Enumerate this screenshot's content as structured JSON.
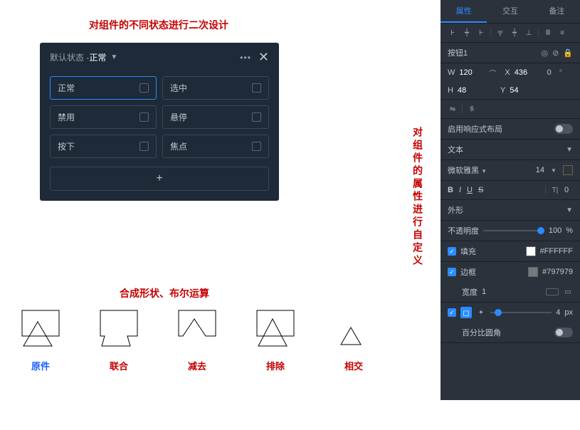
{
  "annotations": {
    "top": "对组件的不同状态进行二次设计",
    "mid": "对组件的属性进行自定义",
    "shape": "合成形状、布尔运算"
  },
  "states_panel": {
    "title_prefix": "默认状态 - ",
    "title_value": "正常",
    "states": {
      "normal": "正常",
      "selected": "选中",
      "disabled": "禁用",
      "hover": "悬停",
      "pressed": "按下",
      "focus": "焦点"
    },
    "add": "+"
  },
  "inspector": {
    "tabs": {
      "attr": "属性",
      "ia": "交互",
      "note": "备注"
    },
    "element_name": "按钮1",
    "geom": {
      "w_label": "W",
      "w": "120",
      "x_label": "X",
      "x": "436",
      "r": "0",
      "h_label": "H",
      "h": "48",
      "y_label": "Y",
      "y": "54"
    },
    "responsive_label": "启用响应式布局",
    "text_section": "文本",
    "font": "微软雅黑",
    "font_size": "14",
    "shape_section": "外形",
    "opacity_label": "不透明度",
    "opacity_value": "100",
    "opacity_unit": "%",
    "fill_label": "填充",
    "fill_value": "#FFFFFF",
    "stroke_label": "边框",
    "stroke_value": "#797979",
    "width_label": "宽度",
    "width_value": "1",
    "radius_value": "4",
    "radius_unit": "px",
    "radius_mode_label": "百分比圆角"
  },
  "shapes": {
    "original": "原件",
    "union": "联合",
    "subtract": "减去",
    "exclude": "排除",
    "intersect": "相交"
  }
}
